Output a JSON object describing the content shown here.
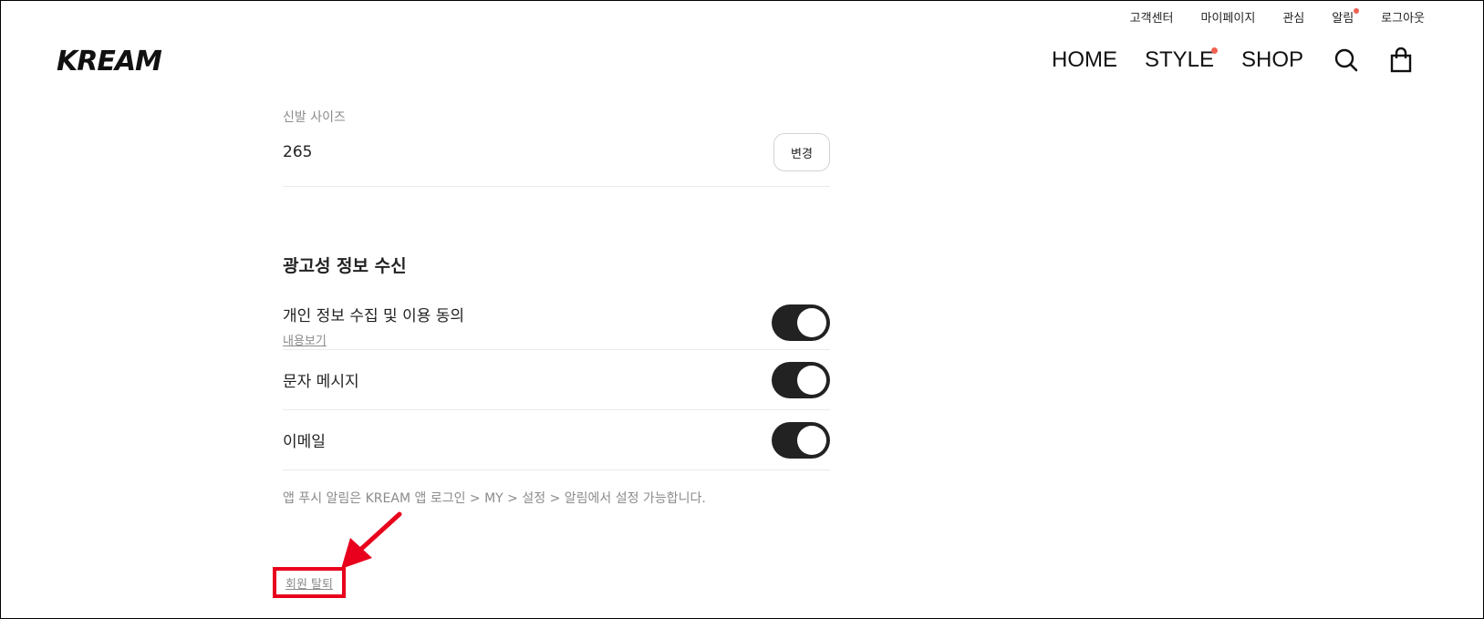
{
  "util_nav": {
    "customer_center": "고객센터",
    "my_page": "마이페이지",
    "interest": "관심",
    "alarm": "알림",
    "logout": "로그아웃"
  },
  "header": {
    "logo": "KREAM",
    "nav": {
      "home": "HOME",
      "style": "STYLE",
      "shop": "SHOP"
    },
    "icons": [
      "search-icon",
      "shopping-bag-icon"
    ]
  },
  "shoe_size": {
    "label": "신발 사이즈",
    "value": "265",
    "change_button": "변경"
  },
  "marketing": {
    "title": "광고성 정보 수신",
    "items": [
      {
        "title": "개인 정보 수집 및 이용 동의",
        "link": "내용보기",
        "enabled": true
      },
      {
        "title": "문자 메시지",
        "enabled": true
      },
      {
        "title": "이메일",
        "enabled": true
      }
    ],
    "push_note": "앱 푸시 알림은 KREAM 앱 로그인 > MY > 설정 > 알림에서 설정 가능합니다."
  },
  "withdraw": {
    "label": "회원 탈퇴"
  },
  "colors": {
    "highlight": "#e8001c",
    "notification_dot": "#ef6253",
    "toggle_on": "#222222"
  }
}
